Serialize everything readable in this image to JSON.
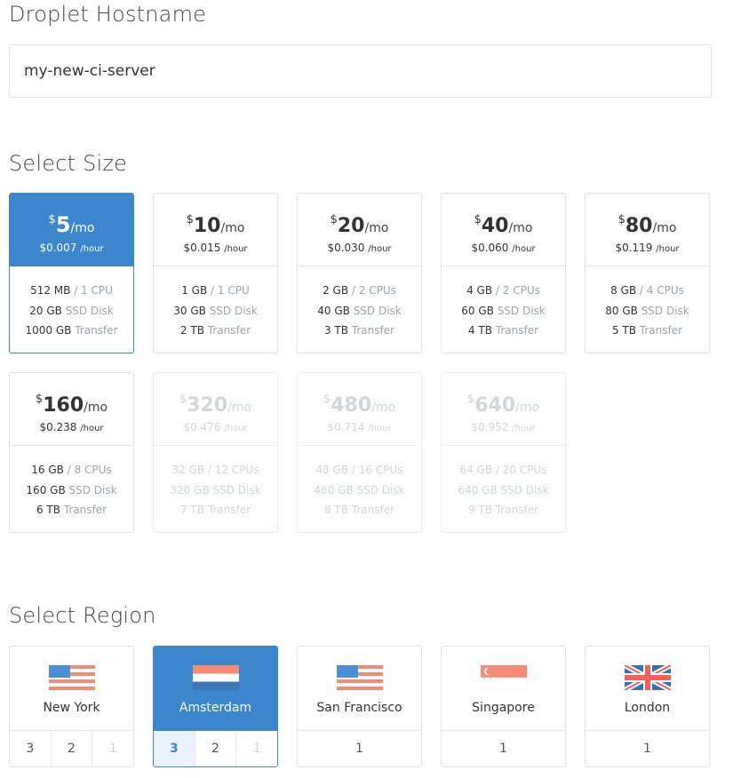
{
  "hostname": {
    "title": "Droplet Hostname",
    "value": "my-new-ci-server"
  },
  "size": {
    "title": "Select Size",
    "options": [
      {
        "symbol": "$",
        "amount": "5",
        "per": "/mo",
        "hourly": "$0.007",
        "hour_unit": "/hour",
        "ram": "512 MB",
        "cpu": "/ 1 CPU",
        "disk": "20 GB",
        "disk_label": "SSD Disk",
        "transfer": "1000 GB",
        "transfer_label": "Transfer"
      },
      {
        "symbol": "$",
        "amount": "10",
        "per": "/mo",
        "hourly": "$0.015",
        "hour_unit": "/hour",
        "ram": "1 GB",
        "cpu": "/ 1 CPU",
        "disk": "30 GB",
        "disk_label": "SSD Disk",
        "transfer": "2 TB",
        "transfer_label": "Transfer"
      },
      {
        "symbol": "$",
        "amount": "20",
        "per": "/mo",
        "hourly": "$0.030",
        "hour_unit": "/hour",
        "ram": "2 GB",
        "cpu": "/ 2 CPUs",
        "disk": "40 GB",
        "disk_label": "SSD Disk",
        "transfer": "3 TB",
        "transfer_label": "Transfer"
      },
      {
        "symbol": "$",
        "amount": "40",
        "per": "/mo",
        "hourly": "$0.060",
        "hour_unit": "/hour",
        "ram": "4 GB",
        "cpu": "/ 2 CPUs",
        "disk": "60 GB",
        "disk_label": "SSD Disk",
        "transfer": "4 TB",
        "transfer_label": "Transfer"
      },
      {
        "symbol": "$",
        "amount": "80",
        "per": "/mo",
        "hourly": "$0.119",
        "hour_unit": "/hour",
        "ram": "8 GB",
        "cpu": "/ 4 CPUs",
        "disk": "80 GB",
        "disk_label": "SSD Disk",
        "transfer": "5 TB",
        "transfer_label": "Transfer"
      },
      {
        "symbol": "$",
        "amount": "160",
        "per": "/mo",
        "hourly": "$0.238",
        "hour_unit": "/hour",
        "ram": "16 GB",
        "cpu": "/ 8 CPUs",
        "disk": "160 GB",
        "disk_label": "SSD Disk",
        "transfer": "6 TB",
        "transfer_label": "Transfer"
      },
      {
        "symbol": "$",
        "amount": "320",
        "per": "/mo",
        "hourly": "$0.476",
        "hour_unit": "/hour",
        "ram": "32 GB",
        "cpu": "/ 12 CPUs",
        "disk": "320 GB",
        "disk_label": "SSD Disk",
        "transfer": "7 TB",
        "transfer_label": "Transfer"
      },
      {
        "symbol": "$",
        "amount": "480",
        "per": "/mo",
        "hourly": "$0.714",
        "hour_unit": "/hour",
        "ram": "48 GB",
        "cpu": "/ 16 CPUs",
        "disk": "480 GB",
        "disk_label": "SSD Disk",
        "transfer": "8 TB",
        "transfer_label": "Transfer"
      },
      {
        "symbol": "$",
        "amount": "640",
        "per": "/mo",
        "hourly": "$0.952",
        "hour_unit": "/hour",
        "ram": "64 GB",
        "cpu": "/ 20 CPUs",
        "disk": "640 GB",
        "disk_label": "SSD Disk",
        "transfer": "9 TB",
        "transfer_label": "Transfer"
      }
    ]
  },
  "region": {
    "title": "Select Region",
    "options": [
      {
        "name": "New York",
        "flag": "us-flag-icon",
        "nums": [
          "3",
          "2",
          "1"
        ]
      },
      {
        "name": "Amsterdam",
        "flag": "netherlands-flag-icon",
        "nums": [
          "3",
          "2",
          "1"
        ]
      },
      {
        "name": "San Francisco",
        "flag": "us-flag-icon",
        "nums": [
          "1"
        ]
      },
      {
        "name": "Singapore",
        "flag": "singapore-flag-icon",
        "nums": [
          "1"
        ]
      },
      {
        "name": "London",
        "flag": "uk-flag-icon",
        "nums": [
          "1"
        ]
      }
    ]
  },
  "colors": {
    "accent": "#3b86cc"
  }
}
